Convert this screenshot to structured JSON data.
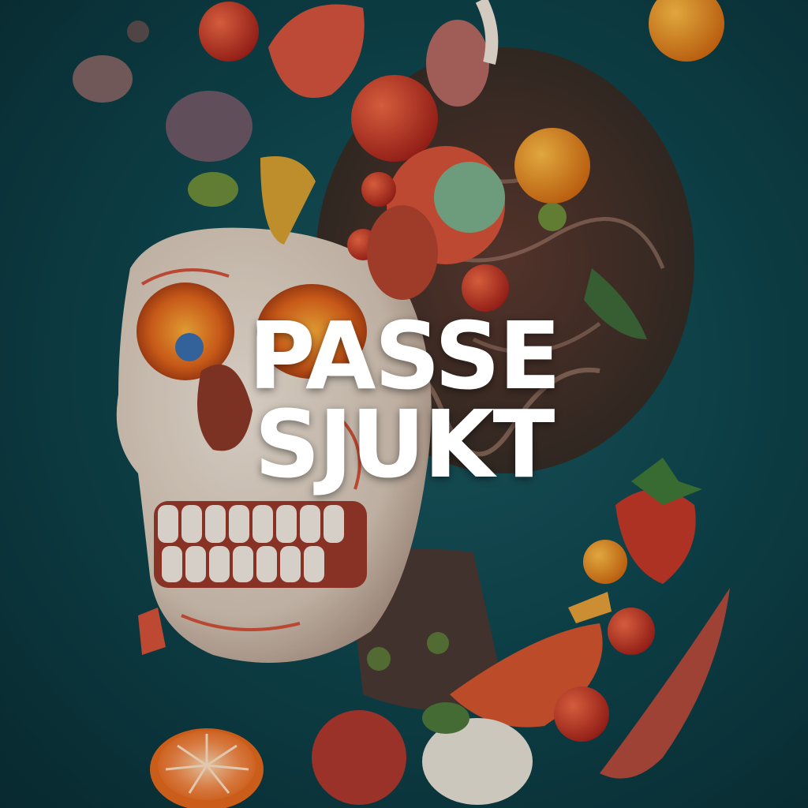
{
  "poster": {
    "headline_line1": "PASSE",
    "headline_line2": "SJUKT"
  },
  "colors": {
    "background": "#0f4850",
    "headline": "#ffffff",
    "bone": "#e8ddd0",
    "tomato": "#d9432a",
    "orange": "#f0962a"
  },
  "illustration": {
    "subject": "skull-with-vegetables-icon"
  }
}
